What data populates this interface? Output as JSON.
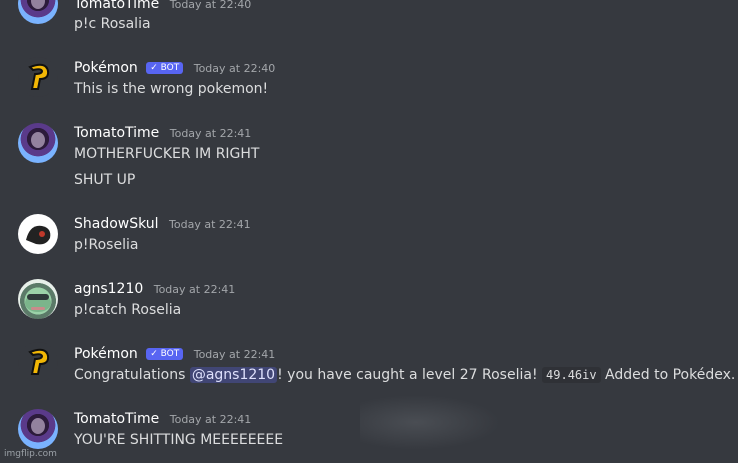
{
  "messages": [
    {
      "author": "TomatoTime",
      "time": "Today at 22:40",
      "bot": false,
      "lines": [
        "p!c Rosalia"
      ]
    },
    {
      "author": "Pokémon",
      "time": "Today at 22:40",
      "bot": true,
      "lines": [
        "This is the wrong pokemon!"
      ]
    },
    {
      "author": "TomatoTime",
      "time": "Today at 22:41",
      "bot": false,
      "lines": [
        "MOTHERFUCKER IM RIGHT",
        "SHUT UP"
      ]
    },
    {
      "author": "ShadowSkul",
      "time": "Today at 22:41",
      "bot": false,
      "lines": [
        "p!Roselia"
      ]
    },
    {
      "author": "agns1210",
      "time": "Today at 22:41",
      "bot": false,
      "lines": [
        "p!catch Roselia"
      ]
    },
    {
      "author": "Pokémon",
      "time": "Today at 22:41",
      "bot": true,
      "congrats": {
        "pre": "Congratulations ",
        "mention": "@agns1210",
        "mid": "! you have caught a level 27 Roselia! ",
        "code": "49.46iv",
        "post": " Added to Pokédex."
      }
    },
    {
      "author": "TomatoTime",
      "time": "Today at 22:41",
      "bot": false,
      "lines": [
        "YOU'RE SHITTING MEEEEEEEE"
      ]
    }
  ],
  "bot_badge": "✓ BOT",
  "watermark": "imgflip.com",
  "colors": {
    "background": "#36393f",
    "mention_bg": "#414675",
    "bot_badge": "#5865f2"
  }
}
